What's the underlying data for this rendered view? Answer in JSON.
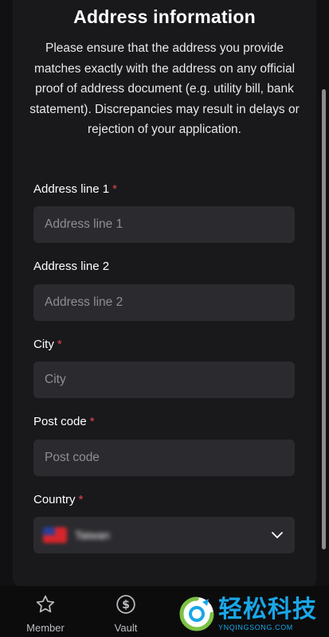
{
  "header": {
    "title": "Address information",
    "description": "Please ensure that the address you provide matches exactly with the address on any official proof of address document (e.g. utility bill, bank statement). Discrepancies may result in delays or rejection of your application."
  },
  "form": {
    "address_line_1": {
      "label": "Address line 1",
      "required_mark": "*",
      "placeholder": "Address line 1",
      "value": ""
    },
    "address_line_2": {
      "label": "Address line 2",
      "placeholder": "Address line 2",
      "value": ""
    },
    "city": {
      "label": "City",
      "required_mark": "*",
      "placeholder": "City",
      "value": ""
    },
    "post_code": {
      "label": "Post code",
      "required_mark": "*",
      "placeholder": "Post code",
      "value": ""
    },
    "country": {
      "label": "Country",
      "required_mark": "*",
      "selected": "Taiwan"
    }
  },
  "bottom_nav": {
    "items": [
      {
        "label": "Member",
        "icon": "star-icon"
      },
      {
        "label": "Vault",
        "icon": "dollar-circle-icon"
      }
    ]
  },
  "watermark": {
    "title": "轻松科技",
    "subtitle": "YNQINGSONG.COM"
  },
  "colors": {
    "background": "#111113",
    "card": "#19191c",
    "field": "#2b2b2f",
    "required": "#e0474c",
    "watermark": "#1aa7e8"
  }
}
